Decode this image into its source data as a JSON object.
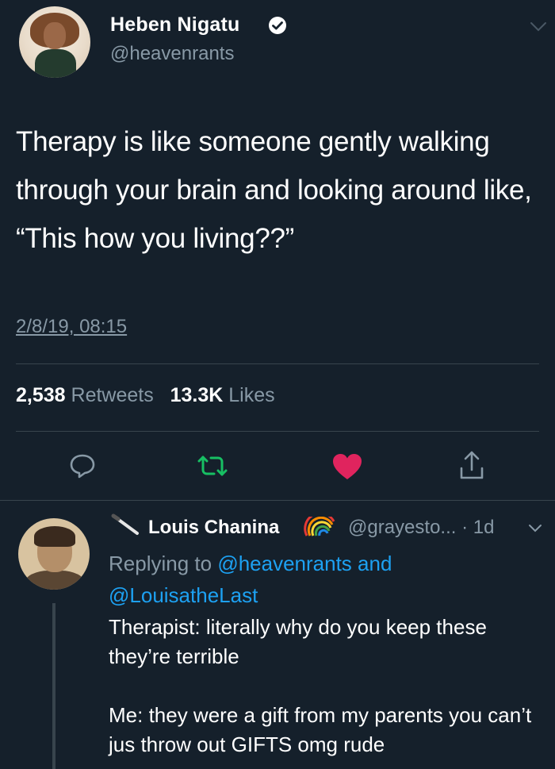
{
  "tweet": {
    "author_name": "Heben Nigatu",
    "author_handle": "@heavenrants",
    "text": "Therapy is like someone gently walking through your brain and looking around like, “This how you living??”",
    "timestamp": "2/8/19, 08:15",
    "retweets_count": "2,538",
    "retweets_label": "Retweets",
    "likes_count": "13.3K",
    "likes_label": "Likes",
    "liked": true
  },
  "actions": [
    {
      "name": "reply-icon"
    },
    {
      "name": "retweet-icon",
      "color": "#17bf63"
    },
    {
      "name": "heart-icon",
      "color": "#e0245e"
    },
    {
      "name": "share-icon"
    }
  ],
  "reply": {
    "author_name": "Louis Chanina",
    "author_handle": "@grayesto... · 1d",
    "replying_prefix": "Replying to",
    "replying_user1": "@heavenrants",
    "replying_and": "and",
    "replying_user2": "@LouisatheLast",
    "paragraph1": "Therapist: literally why do you keep these they’re terrible",
    "paragraph2": "Me: they were a gift from my parents you can’t jus throw out GIFTS omg rude"
  },
  "colors": {
    "background": "#15202b",
    "secondary_text": "#8899a6",
    "link": "#1da1f2",
    "divider": "#38444d"
  }
}
